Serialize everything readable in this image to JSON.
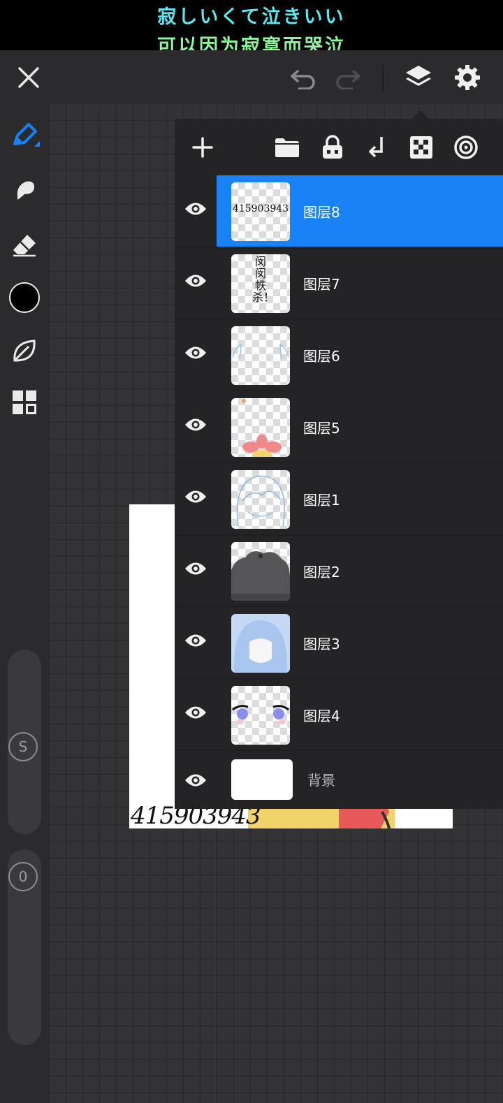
{
  "banner": {
    "line1": "寂しいくて泣きいい",
    "line2": "可以因为寂寞而哭泣"
  },
  "colors": {
    "accent": "#1a82f7",
    "background": "#2b2b2d",
    "panel": "#242426",
    "current_color": "#000000"
  },
  "topbar": {
    "close": "close-icon",
    "undo": "undo-icon",
    "redo": "redo-icon",
    "layers": "layers-icon",
    "settings": "gear-icon"
  },
  "toolbar": {
    "tools": [
      "pen-icon",
      "smudge-icon",
      "eraser-icon",
      "color-swatch",
      "leaf-icon",
      "grid-icon"
    ],
    "size_slider_label": "S",
    "opacity_slider_label": "0"
  },
  "artwork": {
    "signature_text": "415903943",
    "vertical_text": [
      "闵",
      "闵",
      "帙",
      "杀"
    ]
  },
  "layers_panel": {
    "tools": [
      "add-icon",
      "folder-icon",
      "lock-icon",
      "merge-down-icon",
      "transparency-icon",
      "blend-icon"
    ],
    "layers": [
      {
        "name": "图层8",
        "visible": true,
        "selected": true,
        "thumb": "text",
        "thumb_text": "415903943"
      },
      {
        "name": "图层7",
        "visible": true,
        "selected": false,
        "thumb": "vertical-text",
        "thumb_text": "闵闵帙杀！"
      },
      {
        "name": "图层6",
        "visible": true,
        "selected": false,
        "thumb": "ears"
      },
      {
        "name": "图层5",
        "visible": true,
        "selected": false,
        "thumb": "flower"
      },
      {
        "name": "图层1",
        "visible": true,
        "selected": false,
        "thumb": "sketch"
      },
      {
        "name": "图层2",
        "visible": true,
        "selected": false,
        "thumb": "hair"
      },
      {
        "name": "图层3",
        "visible": true,
        "selected": false,
        "thumb": "base"
      },
      {
        "name": "图层4",
        "visible": true,
        "selected": false,
        "thumb": "eyes"
      },
      {
        "name": "背景",
        "visible": true,
        "selected": false,
        "thumb": "white"
      }
    ]
  }
}
